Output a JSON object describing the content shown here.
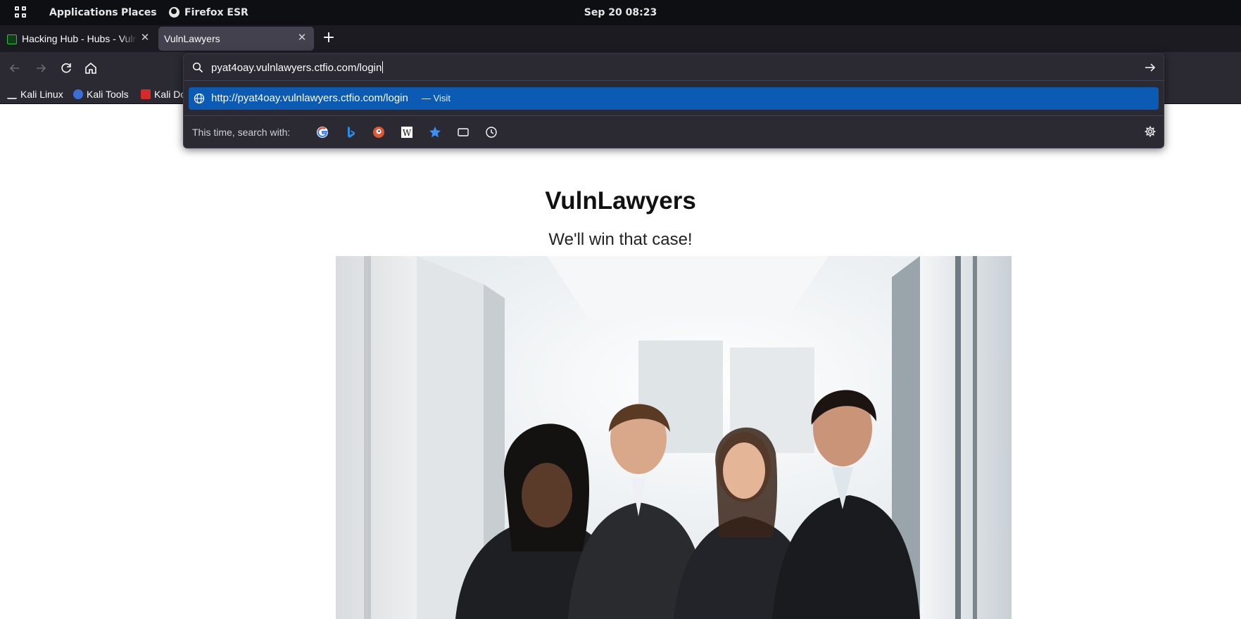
{
  "panel": {
    "applications_label": "Applications",
    "places_label": "Places",
    "app_label": "Firefox ESR",
    "clock": "Sep 20  08:23"
  },
  "tabs": [
    {
      "title": "Hacking Hub - Hubs - Vuln",
      "active": false
    },
    {
      "title": "VulnLawyers",
      "active": true
    }
  ],
  "bookmarks": [
    {
      "label": "Kali Linux",
      "icon": "kali-dragon-icon"
    },
    {
      "label": "Kali Tools",
      "icon": "kali-tools-icon"
    },
    {
      "label": "Kali Docs",
      "icon": "kali-docs-icon"
    }
  ],
  "address_bar": {
    "value": "pyat4oay.vulnlawyers.ctfio.com/login",
    "suggestion_url": "http://pyat4oay.vulnlawyers.ctfio.com/login",
    "suggestion_action": "— Visit",
    "search_with_label": "This time, search with:",
    "engines": [
      "google-icon",
      "bing-icon",
      "duckduckgo-icon",
      "wikipedia-icon",
      "bookmarks-star-icon",
      "tabs-icon",
      "history-clock-icon"
    ]
  },
  "page": {
    "title": "VulnLawyers",
    "tagline": "We'll win that case!",
    "hero_image": "office-team-photo"
  },
  "colors": {
    "panel_bg": "#0d0f12",
    "tabstrip_bg": "#1c1b22",
    "toolbar_bg": "#2b2a33",
    "active_tab_bg": "#42414d",
    "suggestion_highlight": "#0b5ab3"
  }
}
